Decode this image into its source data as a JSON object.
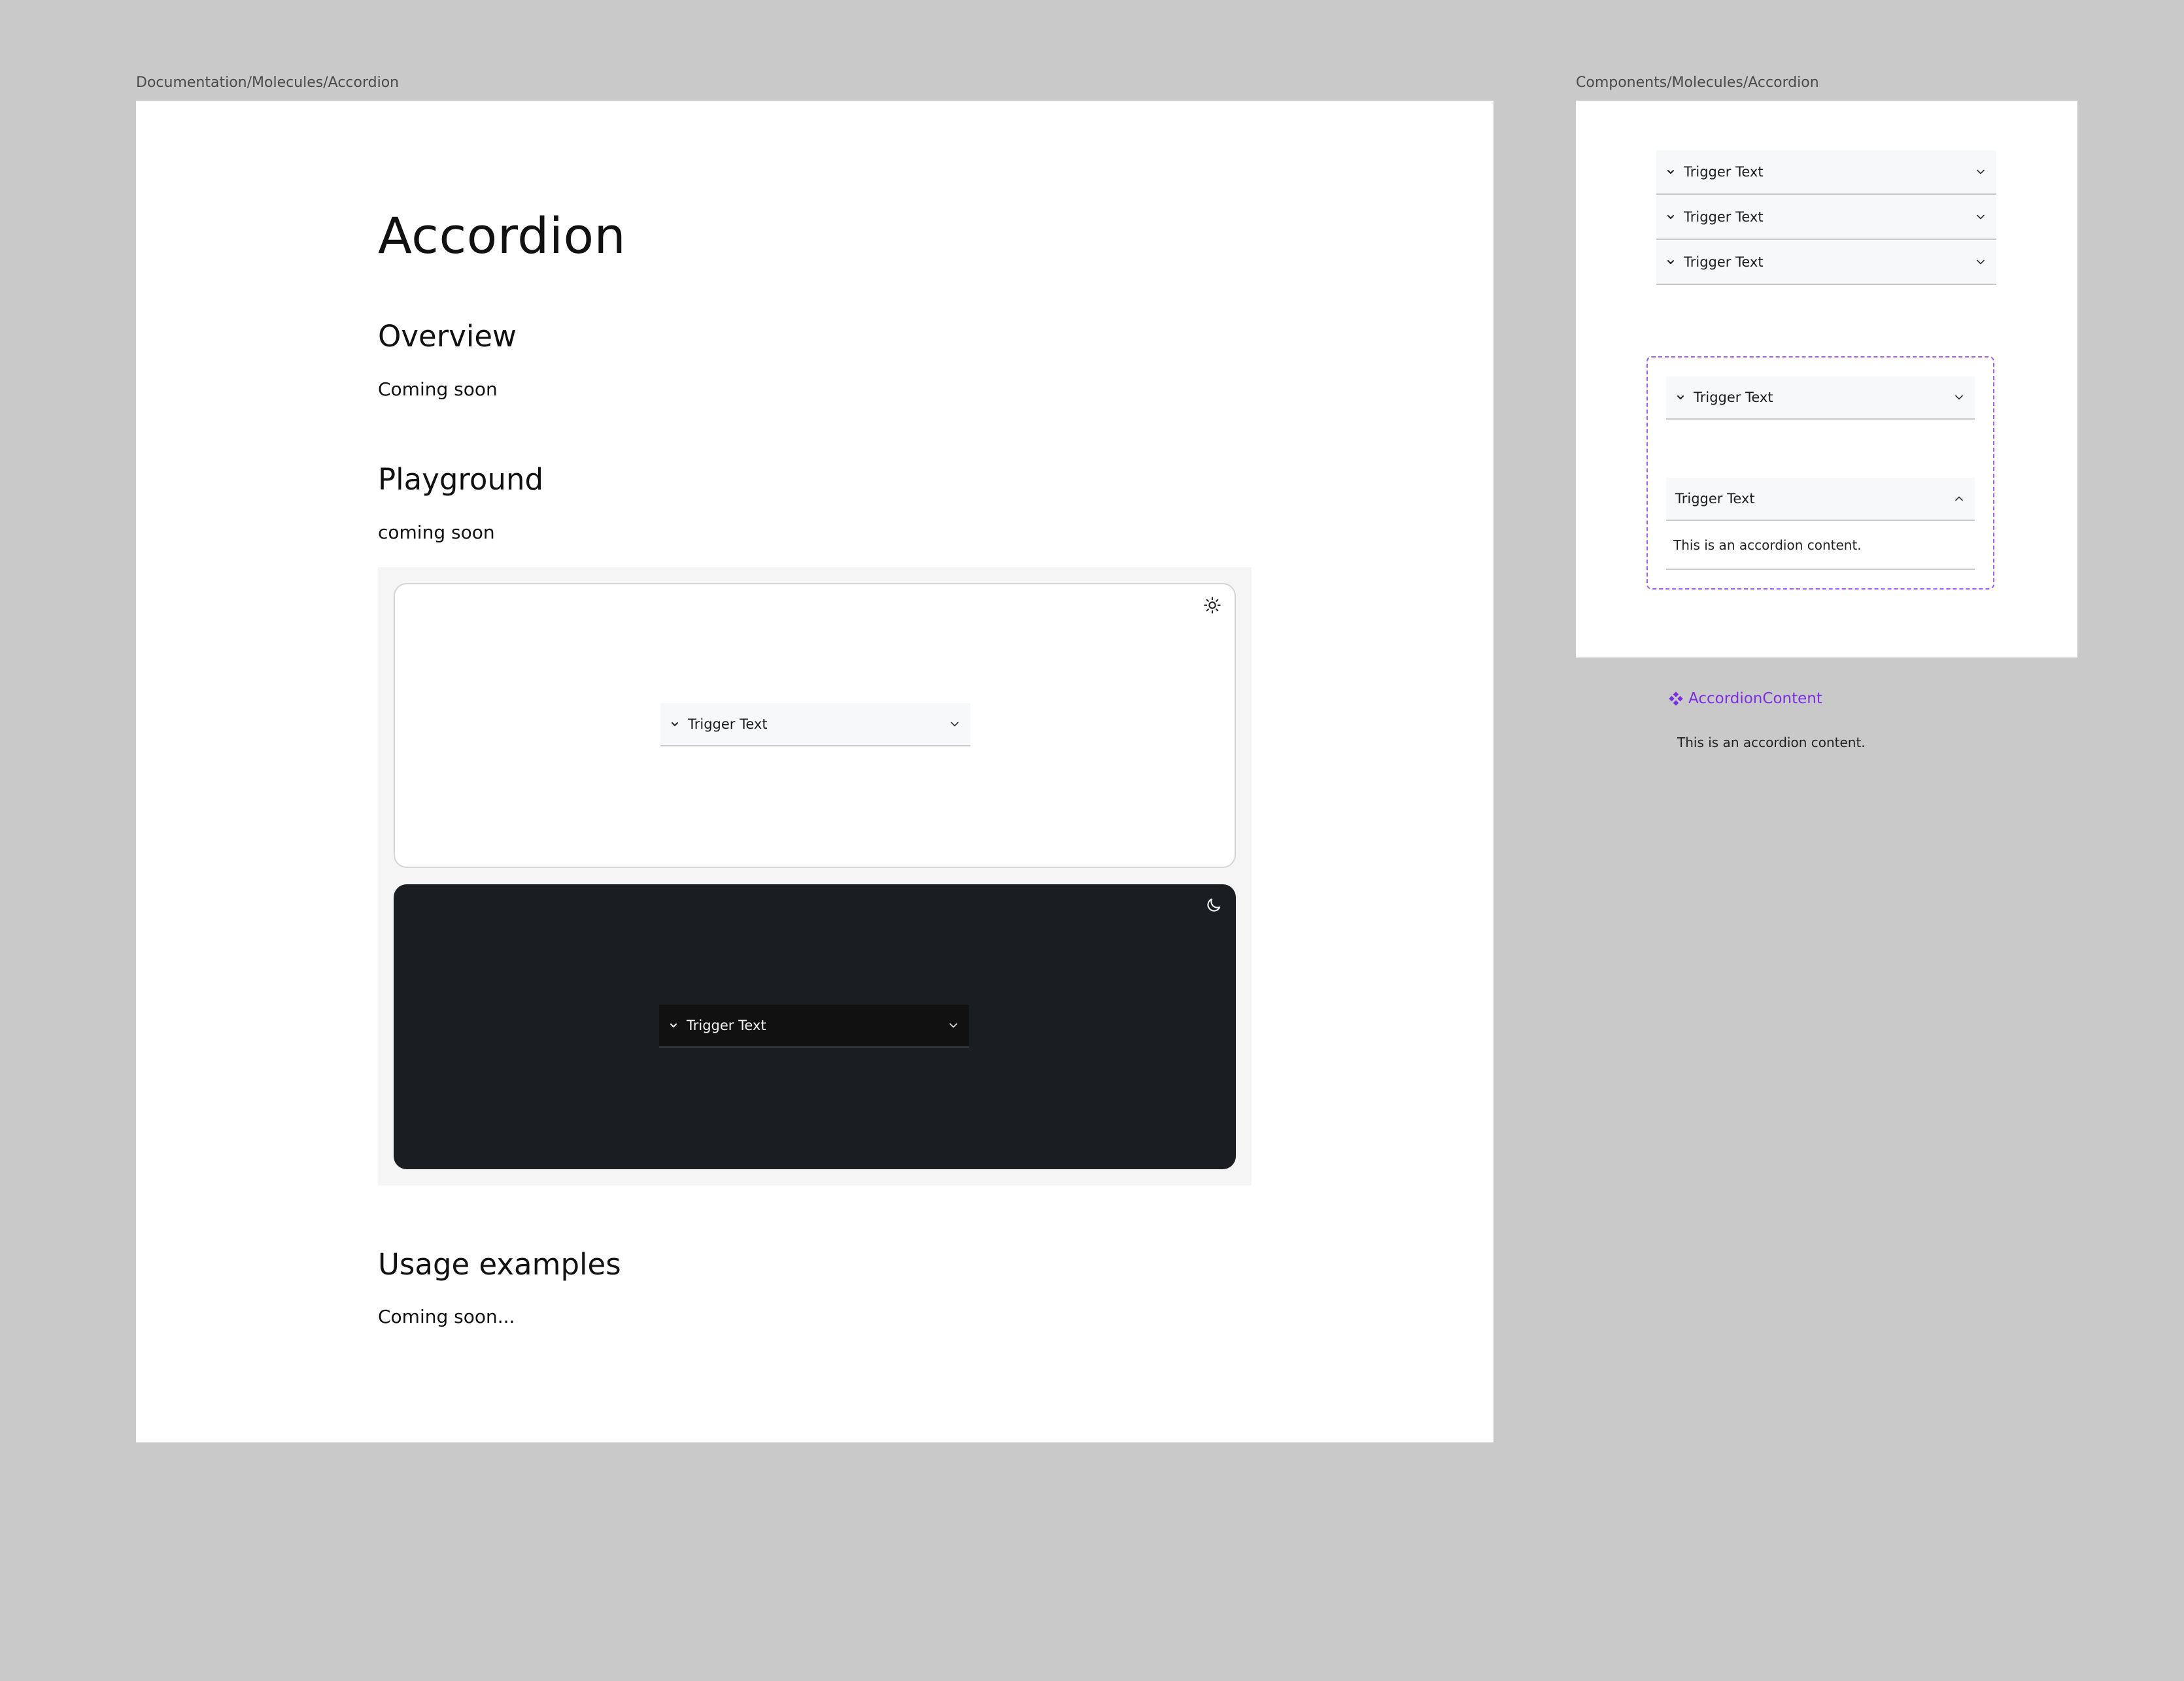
{
  "doc_frame": {
    "label": "Documentation/Molecules/Accordion"
  },
  "comp_frame": {
    "label": "Components/Molecules/Accordion"
  },
  "doc": {
    "title": "Accordion",
    "overview_heading": "Overview",
    "overview_text": "Coming soon",
    "playground_heading": "Playground",
    "playground_text": "coming soon",
    "usage_heading": "Usage examples",
    "usage_text": "Coming soon..."
  },
  "playground": {
    "light_trigger": "Trigger Text",
    "dark_trigger": "Trigger Text",
    "light_icon": "sun-icon",
    "dark_icon": "moon-icon"
  },
  "components": {
    "stack": [
      "Trigger Text",
      "Trigger Text",
      "Trigger Text"
    ],
    "variant_closed": "Trigger Text",
    "variant_open": "Trigger Text",
    "open_content": "This is an accordion content.",
    "content_component_name": "AccordionContent",
    "content_component_text": "This is an accordion content."
  },
  "colors": {
    "canvas": "#c9c9c9",
    "dark_panel": "#1a1d21",
    "component_accent": "#a259ff",
    "component_label": "#7b2fe0"
  }
}
